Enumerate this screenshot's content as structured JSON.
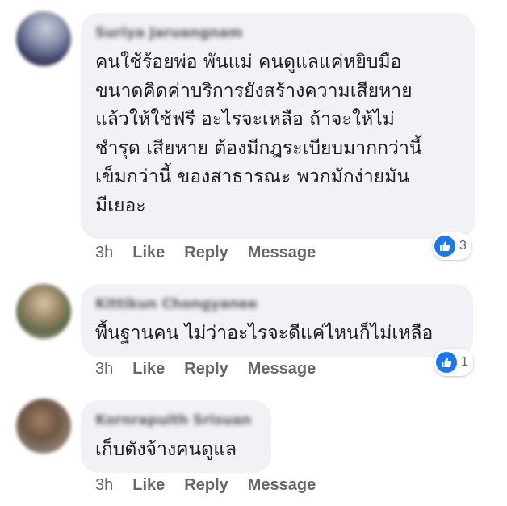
{
  "colors": {
    "bubble_bg": "#f0f2f5",
    "meta_text": "#65676b",
    "like_blue": "#1877f2"
  },
  "comments": [
    {
      "author": "Suriya Jaruangnam",
      "text": "คนใช้ร้อยพ่อ พันแม่  คนดูแลแค่หยิบมือ\nขนาดคิดค่าบริการยังสร้างความเสียหาย\nแล้วให้ใช้ฟรี  อะไรจะเหลือ  ถ้าจะให้ไม่\nชำรุด เสียหาย ต้องมีกฎระเบียบมากกว่านี้\nเข็มกว่านี้ ของสาธารณะ พวกมักง่ายมัน\nมีเยอะ",
      "time": "3h",
      "like_label": "Like",
      "reply_label": "Reply",
      "message_label": "Message",
      "reaction_icon": "like-icon",
      "reaction_count": "3"
    },
    {
      "author": "Kittikun Chongyanee",
      "text": "พื้นฐานคน ไม่ว่าอะไรจะดีแค่ไหนก็ไม่เหลือ",
      "time": "3h",
      "like_label": "Like",
      "reply_label": "Reply",
      "message_label": "Message",
      "reaction_icon": "like-icon",
      "reaction_count": "1"
    },
    {
      "author": "Kornrapuith Srisuan",
      "text": "เก็บตังจ้างคนดูแล",
      "time": "3h",
      "like_label": "Like",
      "reply_label": "Reply",
      "message_label": "Message"
    }
  ]
}
